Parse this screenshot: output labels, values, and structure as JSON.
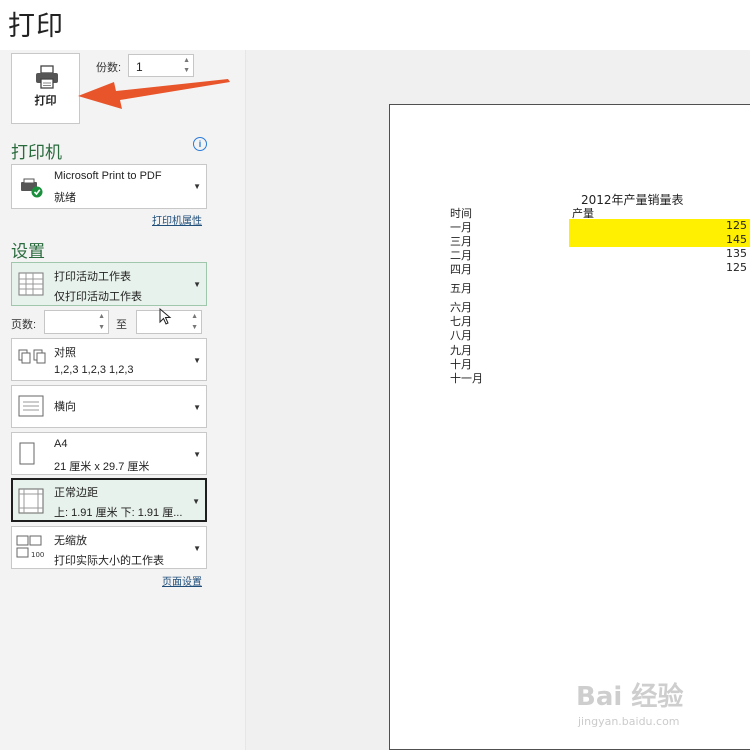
{
  "header": {
    "title": "打印"
  },
  "print_button": {
    "label": "打印"
  },
  "copies": {
    "label": "份数:",
    "value": "1"
  },
  "printer": {
    "section_title": "打印机",
    "name": "Microsoft Print to PDF",
    "status": "就绪",
    "properties_link": "打印机属性"
  },
  "settings": {
    "section_title": "设置",
    "scope": {
      "line1": "打印活动工作表",
      "line2": "仅打印活动工作表"
    },
    "pages": {
      "label": "页数:",
      "to_label": "至",
      "from_value": "",
      "to_value": ""
    },
    "collate": {
      "line1": "对照",
      "line2": "1,2,3    1,2,3    1,2,3"
    },
    "orientation": {
      "line1": "横向"
    },
    "paper": {
      "line1": "A4",
      "line2": "21 厘米 x 29.7 厘米"
    },
    "margins": {
      "line1": "正常边距",
      "line2": "上: 1.91 厘米 下: 1.91 厘..."
    },
    "scaling": {
      "line1": "无缩放",
      "line2": "打印实际大小的工作表"
    },
    "page_setup_link": "页面设置"
  },
  "preview": {
    "sheet_title": "2012年产量销量表",
    "col_time": "时间",
    "col_output": "产量",
    "months": [
      "一月",
      "三月",
      "二月",
      "四月",
      "五月",
      "六月",
      "七月",
      "八月",
      "九月",
      "十月",
      "十一月"
    ],
    "values": [
      "125",
      "145",
      "135",
      "125"
    ],
    "highlight_color": "#ffef00"
  },
  "watermark": {
    "brand": "Bai 经验",
    "url": "jingyan.baidu.com"
  },
  "colors": {
    "section_green": "#2a6b3e",
    "arrow": "#e8552b"
  }
}
